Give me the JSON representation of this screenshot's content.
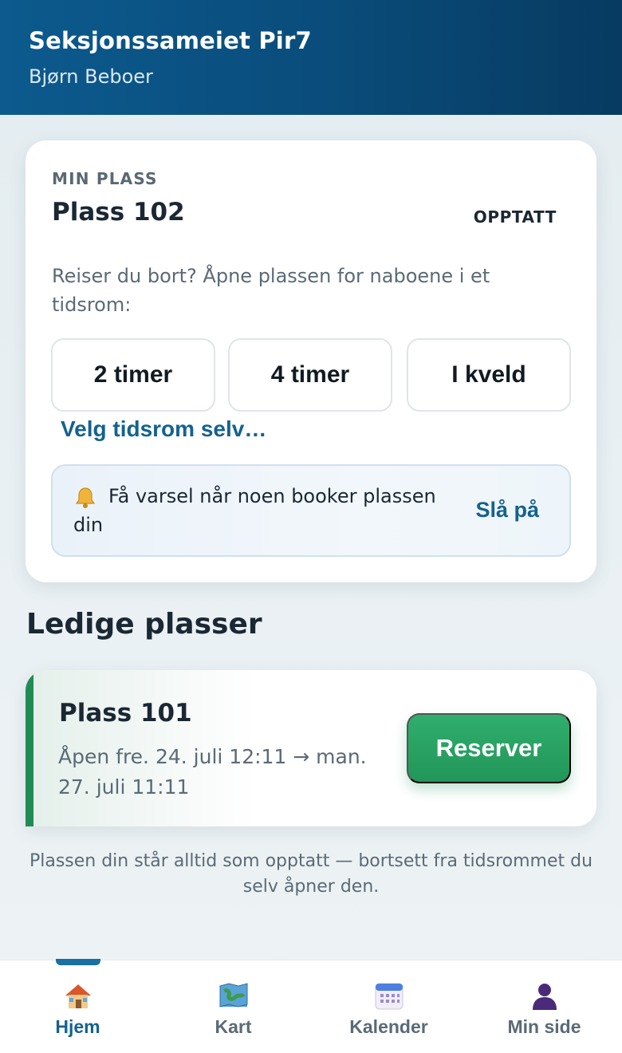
{
  "header": {
    "title": "Seksjonssameiet Pir7",
    "user": "Bjørn Beboer"
  },
  "my_spot": {
    "eyebrow": "MIN PLASS",
    "name": "Plass 102",
    "status": "OPPTATT",
    "description": "Reiser du bort? Åpne plassen for naboene i et tidsrom:",
    "durations": [
      "2 timer",
      "4 timer",
      "I kveld"
    ],
    "custom_link": "Velg tidsrom selv…",
    "notify_text": "Få varsel når noen booker plassen din",
    "notify_action": "Slå på"
  },
  "available": {
    "section_title": "Ledige plasser",
    "items": [
      {
        "name": "Plass 101",
        "window": "Åpen fre. 24. juli 12:11 → man. 27. juli 11:11",
        "action": "Reserver"
      }
    ]
  },
  "footnote": "Plassen din står alltid som opptatt — bortsett fra tidsrommet du selv åpner den.",
  "tabs": [
    {
      "label": "Hjem",
      "icon": "house-icon",
      "active": true
    },
    {
      "label": "Kart",
      "icon": "map-icon",
      "active": false
    },
    {
      "label": "Kalender",
      "icon": "calendar-icon",
      "active": false
    },
    {
      "label": "Min side",
      "icon": "person-icon",
      "active": false
    }
  ],
  "colors": {
    "header": "#0a4d7c",
    "accent_blue": "#14628f",
    "green": "#22965a"
  }
}
